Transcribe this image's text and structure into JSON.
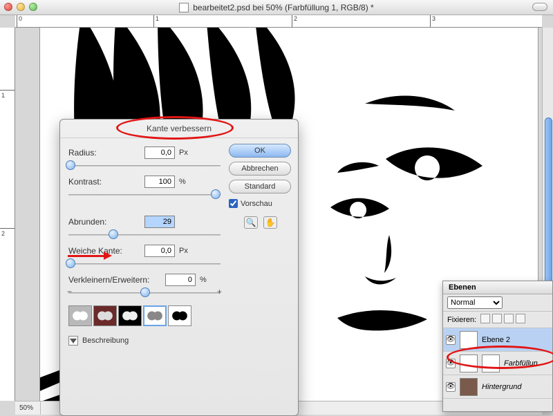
{
  "window": {
    "title": "bearbeitet2.psd bei 50% (Farbfüllung 1, RGB/8) *",
    "zoom_label": "50%",
    "ruler_h": [
      "0",
      "1",
      "2",
      "3"
    ],
    "ruler_v": [
      "1",
      "2"
    ]
  },
  "dialog": {
    "title": "Kante verbessern",
    "fields": {
      "radius_label": "Radius:",
      "radius_value": "0,0",
      "radius_unit": "Px",
      "contrast_label": "Kontrast:",
      "contrast_value": "100",
      "contrast_unit": "%",
      "smooth_label": "Abrunden:",
      "smooth_value": "29",
      "feather_label": "Weiche Kante:",
      "feather_value": "0,0",
      "feather_unit": "Px",
      "expand_label": "Verkleinern/Erweitern:",
      "expand_value": "0",
      "expand_unit": "%",
      "expand_minus": "−",
      "expand_plus": "+"
    },
    "buttons": {
      "ok": "OK",
      "cancel": "Abbrechen",
      "default": "Standard"
    },
    "preview_label": "Vorschau",
    "description_label": "Beschreibung"
  },
  "layers": {
    "title": "Ebenen",
    "blend_mode": "Normal",
    "lock_label": "Fixieren:",
    "rows": [
      {
        "name": "Ebene 2"
      },
      {
        "name": "Farbfüllun"
      },
      {
        "name": "Hintergrund"
      }
    ]
  }
}
